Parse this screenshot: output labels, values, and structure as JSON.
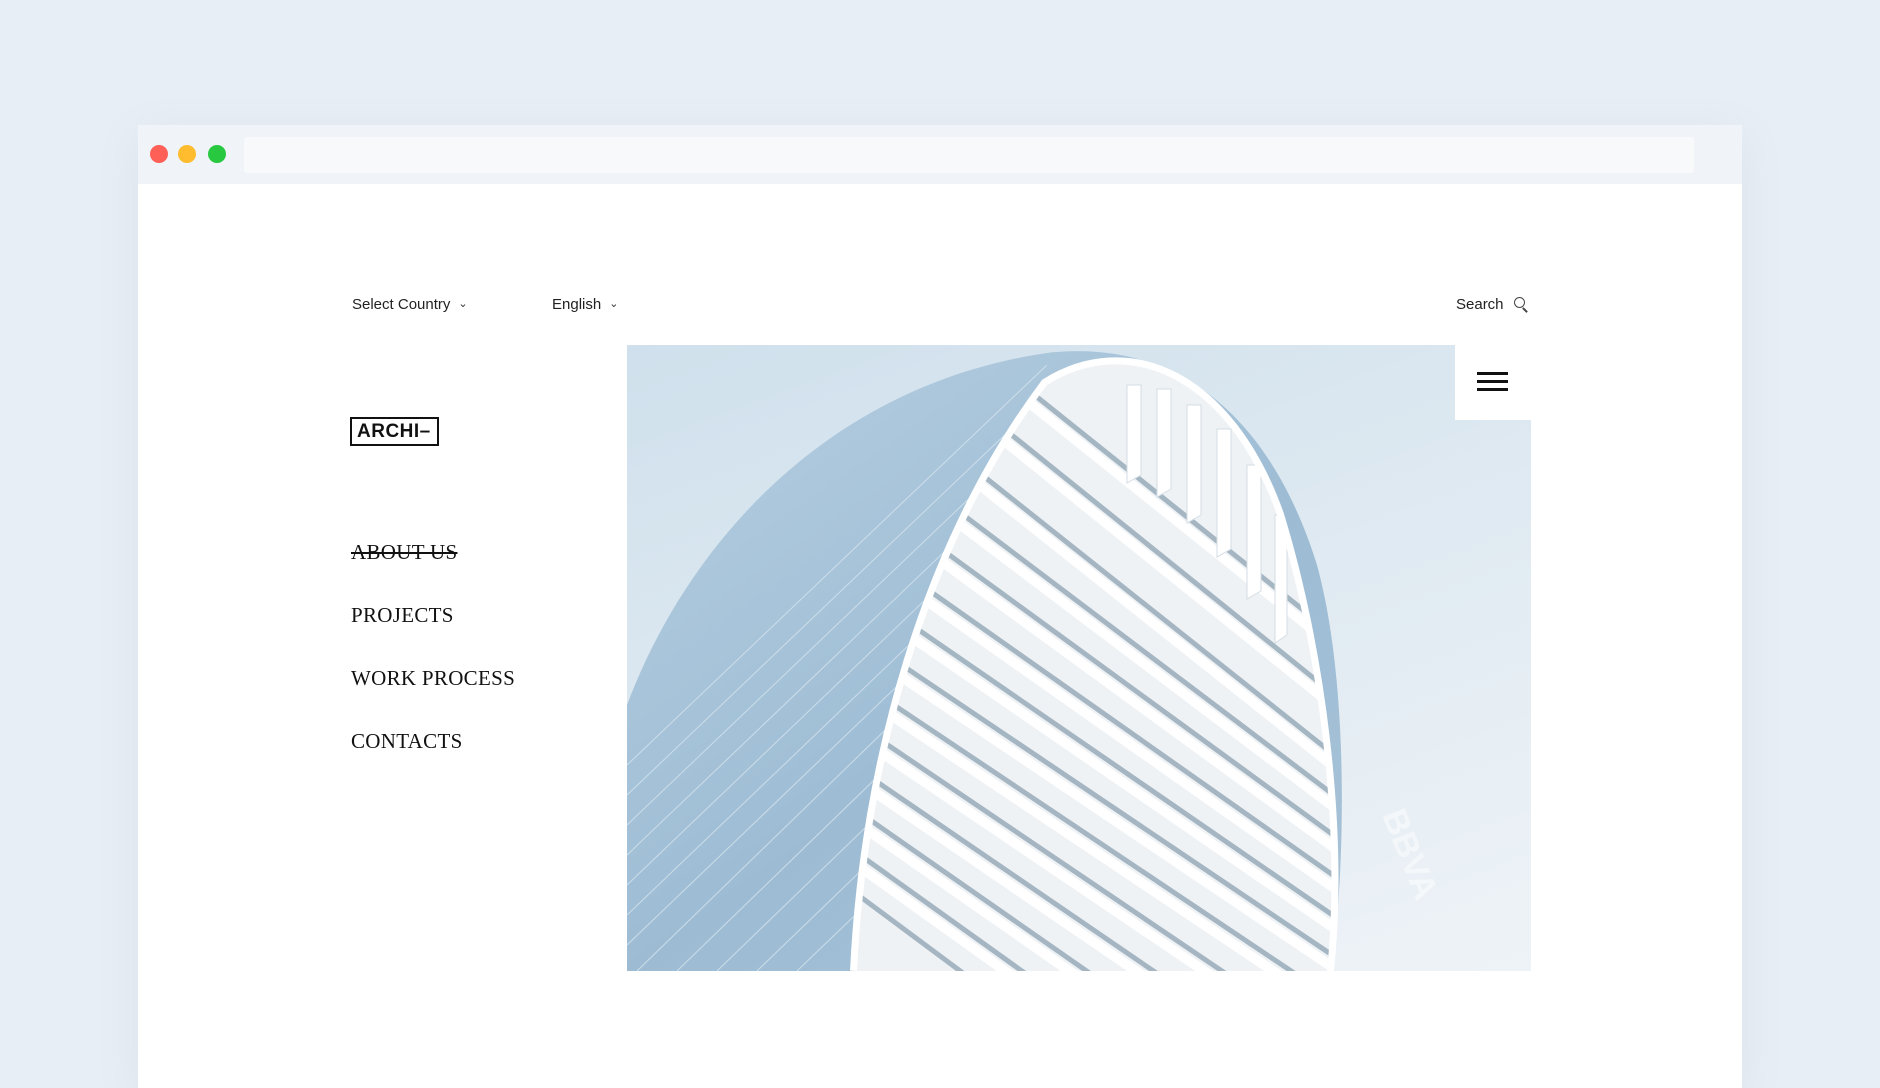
{
  "header": {
    "country_label": "Select Country",
    "language_label": "English",
    "search_label": "Search",
    "chevron": "⌄"
  },
  "brand": {
    "logo_text": "ARCHI–"
  },
  "nav": {
    "items": [
      {
        "label": "ABOUT US",
        "active": true
      },
      {
        "label": "PROJECTS",
        "active": false
      },
      {
        "label": "WORK PROCESS",
        "active": false
      },
      {
        "label": "CONTACTS",
        "active": false
      }
    ]
  },
  "hero": {
    "image": "curved-white-skyscraper-facade",
    "building_sign": "BBVA"
  },
  "icons": {
    "menu": "hamburger-icon",
    "search": "search-icon"
  },
  "colors": {
    "background": "#e8eef5",
    "text": "#111111",
    "window_close": "#fe5f57",
    "window_minimize": "#febc2e",
    "window_maximize": "#28c840"
  }
}
